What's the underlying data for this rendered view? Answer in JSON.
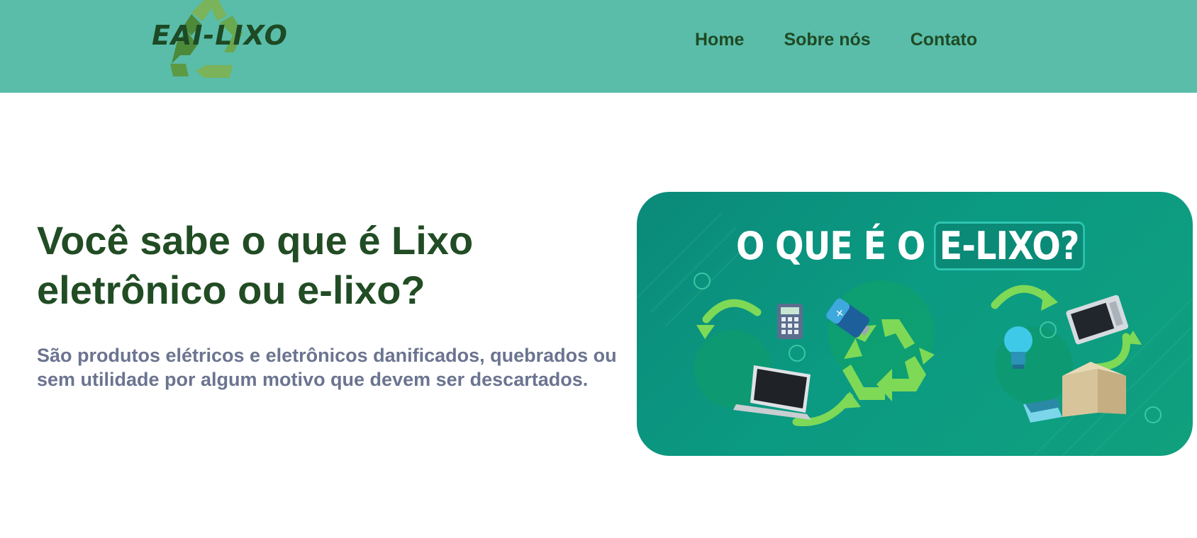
{
  "header": {
    "logo_text": "EAI-LIXO",
    "nav": [
      {
        "label": "Home"
      },
      {
        "label": "Sobre nós"
      },
      {
        "label": "Contato"
      }
    ]
  },
  "hero": {
    "title": "Você sabe o que é Lixo eletrônico ou e-lixo?",
    "description": "São produtos elétricos e eletrônicos danificados, quebrados ou sem utilidade por algum motivo que devem ser descartados."
  },
  "banner": {
    "title_part1": "O QUE É O",
    "title_part2": "E-LIXO?"
  },
  "colors": {
    "header_bg": "#59bdaa",
    "title": "#214c24",
    "description": "#6b7490",
    "banner_bg": "#0b9a82",
    "recycle_green": "#7ed957"
  },
  "icons": [
    "recycle-icon",
    "calculator-icon",
    "battery-icon",
    "laptop-icon",
    "lightbulb-icon",
    "microwave-icon",
    "box-icon",
    "circular-arrow-icon"
  ]
}
